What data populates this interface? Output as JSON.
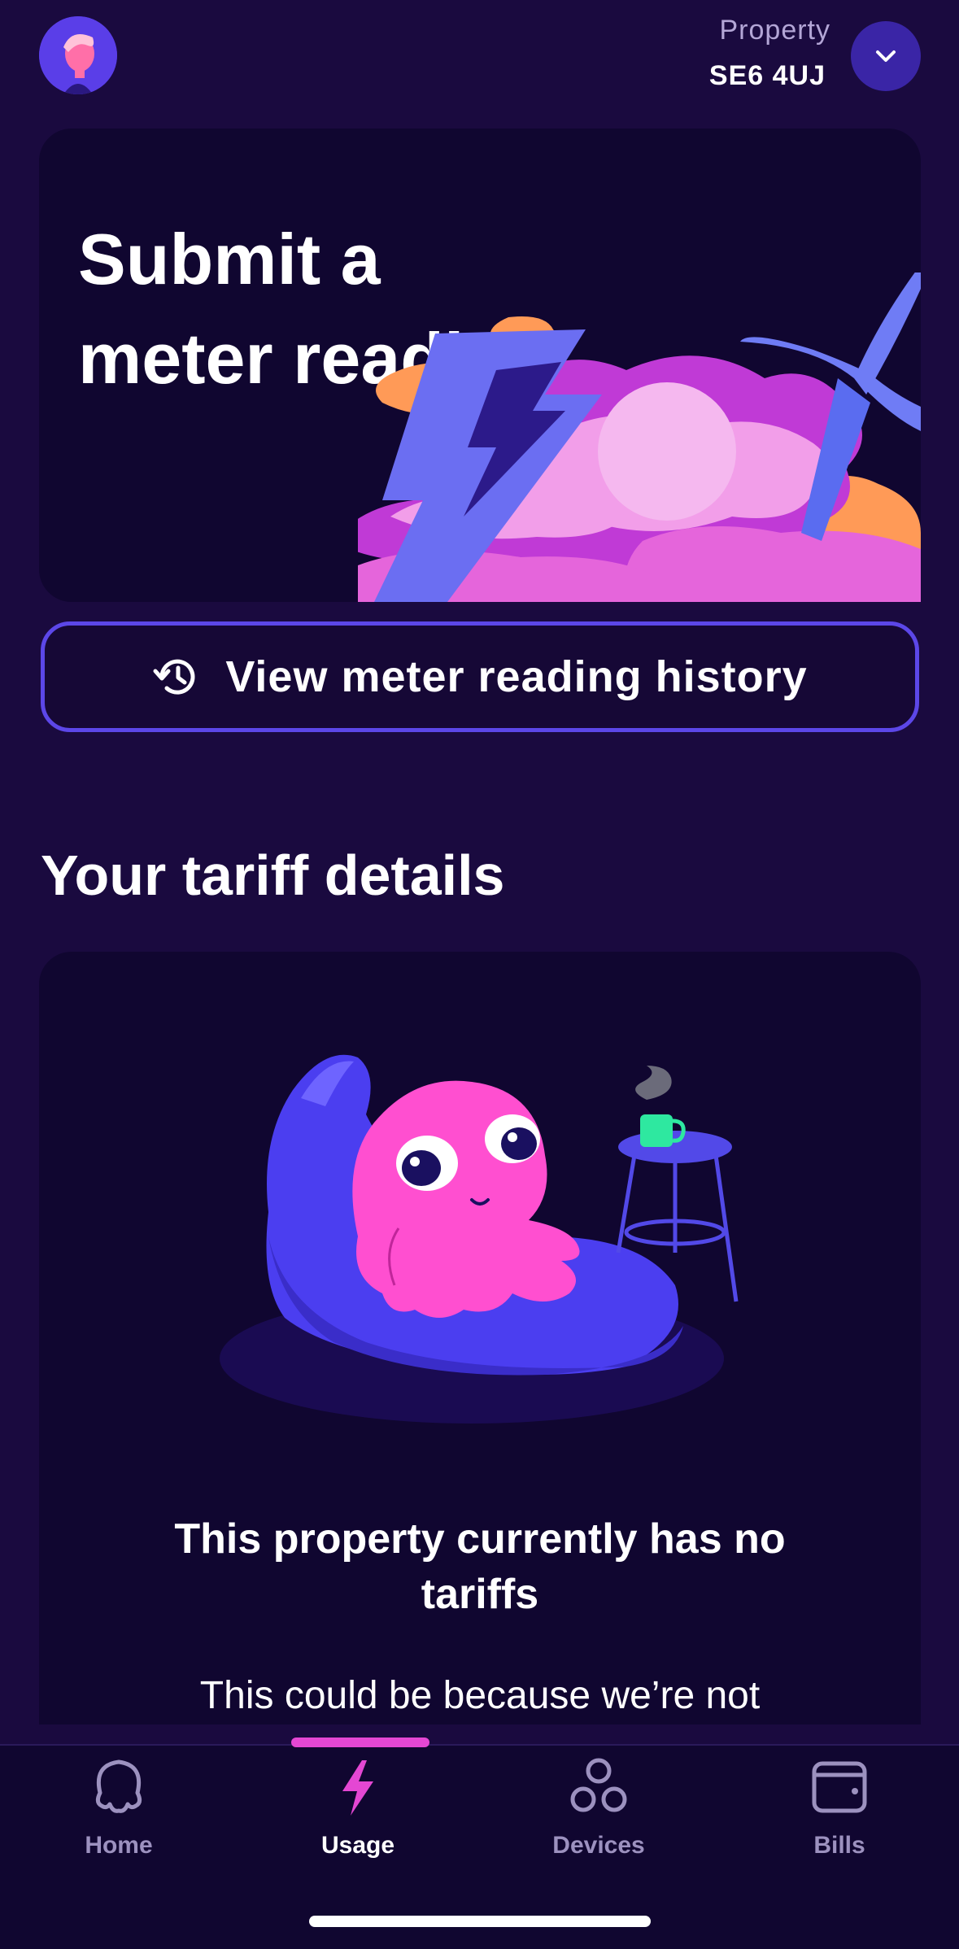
{
  "header": {
    "property_label": "Property",
    "property_value": "SE6 4UJ"
  },
  "meter_card": {
    "title": "Submit a meter reading"
  },
  "history_button": {
    "label": "View meter reading history"
  },
  "tariff_section": {
    "title": "Your tariff details",
    "empty_heading": "This property currently has no tariffs",
    "empty_body": "This could be because we’re not"
  },
  "tabs": [
    {
      "label": "Home",
      "icon": "octopus-icon",
      "active": false
    },
    {
      "label": "Usage",
      "icon": "lightning-icon",
      "active": true
    },
    {
      "label": "Devices",
      "icon": "devices-icon",
      "active": false
    },
    {
      "label": "Bills",
      "icon": "wallet-icon",
      "active": false
    }
  ],
  "colors": {
    "background": "#1a0a3f",
    "card": "#100630",
    "accent": "#5c47e8",
    "pink": "#e447d3"
  }
}
